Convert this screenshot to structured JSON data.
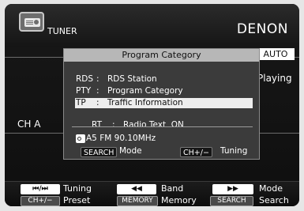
{
  "header": {
    "source_label": "TUNER",
    "brand": "DENON",
    "source_icon": "tuner-radio-icon"
  },
  "status": {
    "mode_badge": "AUTO",
    "playing": "Playing",
    "channel": "CH A"
  },
  "dialog": {
    "title": "Program Category",
    "items": [
      {
        "key": "RDS",
        "sep": ":",
        "label": "RDS Station"
      },
      {
        "key": "PTY",
        "sep": ":",
        "label": "Program Category"
      },
      {
        "key": "TP",
        "sep": ":",
        "label": "Traffic Information",
        "selected": true
      },
      {
        "key": "RT",
        "sep": ":",
        "label": "Radio Text  ON"
      }
    ],
    "frequency": "A5 FM 90.10MHz",
    "search_btn": "SEARCH",
    "search_text": "Mode",
    "ch_btn": "CH+/−",
    "ch_text": "Tuning"
  },
  "footer": {
    "skip_btn": "⏮/⏭",
    "skip_label": "Tuning",
    "rew_btn": "◀◀",
    "rew_label": "Band",
    "ff_btn": "▶▶",
    "ff_label": "Mode",
    "ch_btn": "CH+/−",
    "ch_label": "Preset",
    "memory_btn": "MEMORY",
    "memory_label": "Memory",
    "search_btn": "SEARCH",
    "search_label": "Search"
  }
}
